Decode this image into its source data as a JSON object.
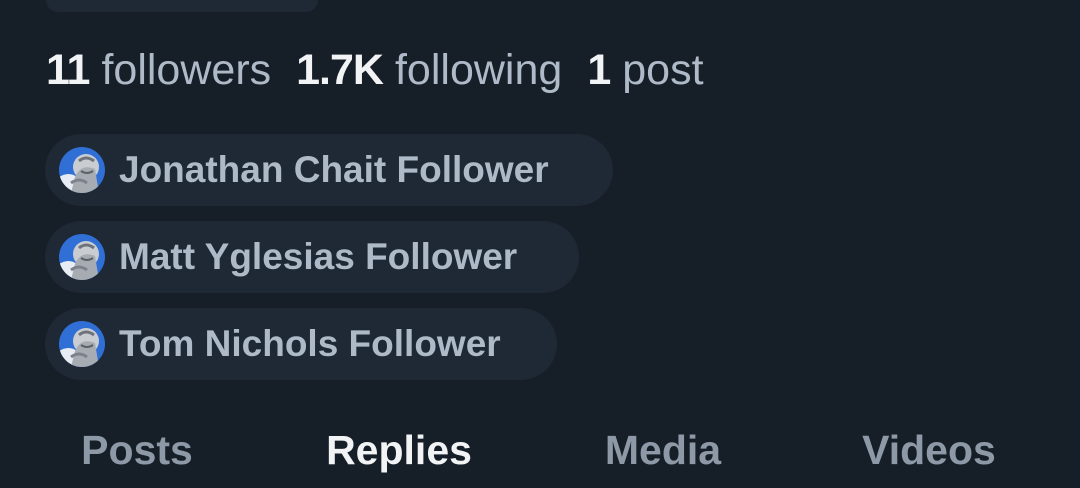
{
  "stats": [
    {
      "count": "11",
      "label": "followers"
    },
    {
      "count": "1.7K",
      "label": "following"
    },
    {
      "count": "1",
      "label": "post"
    }
  ],
  "lists": [
    {
      "label": "Jonathan Chait Follower",
      "icon": "statue-avatar-icon"
    },
    {
      "label": "Matt Yglesias Follower",
      "icon": "statue-avatar-icon"
    },
    {
      "label": "Tom Nichols Follower",
      "icon": "statue-avatar-icon"
    }
  ],
  "tabs": [
    {
      "label": "Posts",
      "active": false
    },
    {
      "label": "Replies",
      "active": true
    },
    {
      "label": "Media",
      "active": false
    },
    {
      "label": "Videos",
      "active": false
    }
  ],
  "colors": {
    "background": "#161e27",
    "pill": "#1f2935",
    "text_primary": "#f1f3f5",
    "text_secondary": "#aebac8",
    "text_tab_inactive": "#8d99a6",
    "avatar_blue": "#2f6fd6"
  }
}
